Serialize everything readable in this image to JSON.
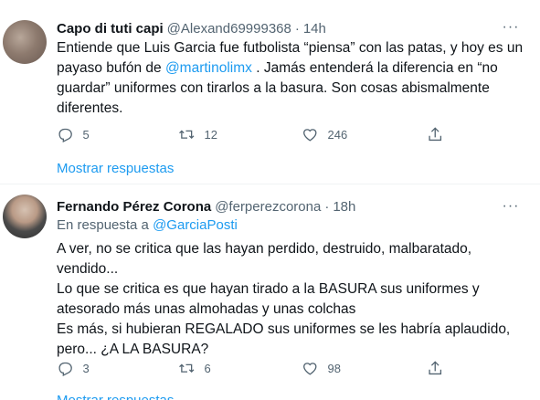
{
  "tweets": [
    {
      "name": "Capo di tuti capi",
      "handle": "@Alexand69999368",
      "time": "14h",
      "body_parts": [
        "Entiende que Luis Garcia fue futbolista “piensa” con las patas, y hoy es un payaso bufón de ",
        "@martinolimx",
        " . Jamás entenderá la diferencia en “no guardar” uniformes con tirarlos a la basura. Son cosas abismalmente diferentes."
      ],
      "replies": "5",
      "retweets": "12",
      "likes": "246",
      "show_replies": "Mostrar respuestas"
    },
    {
      "name": "Fernando Pérez Corona",
      "handle": "@ferperezcorona",
      "time": "18h",
      "reply_prefix": "En respuesta a ",
      "reply_to": "@GarciaPosti",
      "body_lines": [
        "A ver, no se critica que las hayan perdido, destruido, malbaratado, vendido...",
        "Lo que se critica es que hayan tirado a la BASURA sus uniformes y atesorado más unas almohadas y unas colchas",
        "Es más, si hubieran REGALADO sus uniformes se les habría aplaudido, pero... ¿A LA BASURA?"
      ],
      "replies": "3",
      "retweets": "6",
      "likes": "98",
      "show_replies": "Mostrar respuestas"
    }
  ],
  "colors": {
    "link": "#1d9bf0",
    "secondary": "#536471",
    "text": "#0f1419"
  }
}
